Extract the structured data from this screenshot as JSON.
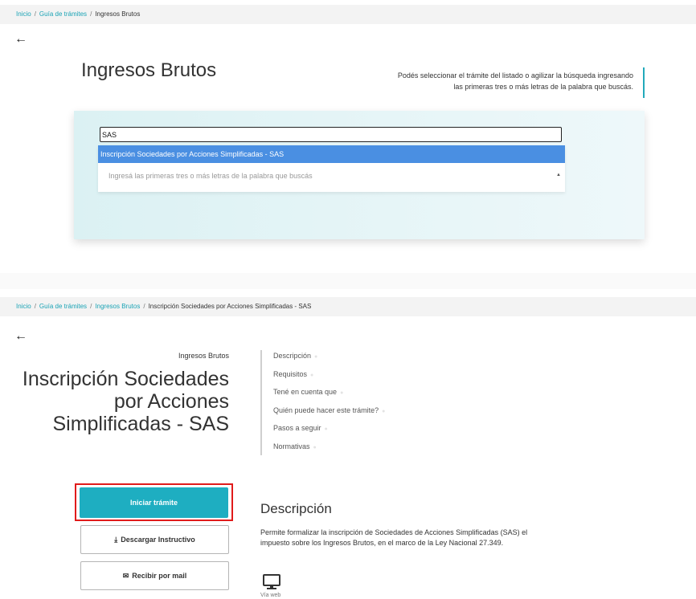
{
  "top": {
    "breadcrumb": {
      "home": "Inicio",
      "guide": "Guía de trámites",
      "current": "Ingresos Brutos",
      "separator": "/"
    },
    "back_icon": "arrow-left-icon",
    "title": "Ingresos Brutos",
    "help_line1": "Podés seleccionar el trámite del listado o agilizar la búsqueda ingresando",
    "help_line2": "las primeras tres o más letras de la palabra que buscás.",
    "search": {
      "value": "SAS",
      "option": "Inscripción Sociedades por Acciones Simplificadas - SAS",
      "placeholder": "Ingresá las primeras tres o más letras de la palabra que buscás"
    }
  },
  "detail": {
    "breadcrumb": {
      "home": "Inicio",
      "guide": "Guía de trámites",
      "category": "Ingresos Brutos",
      "current": "Inscripción Sociedades por Acciones Simplificadas - SAS",
      "separator": "/"
    },
    "back_icon": "arrow-left-icon",
    "category": "Ingresos Brutos",
    "title_line1": "Inscripción Sociedades",
    "title_line2": "por Acciones",
    "title_line3": "Simplificadas - SAS",
    "toc": [
      {
        "label": "Descripción"
      },
      {
        "label": "Requisitos"
      },
      {
        "label": "Tené en cuenta que"
      },
      {
        "label": "Quién puede hacer este trámite?"
      },
      {
        "label": "Pasos a seguir"
      },
      {
        "label": "Normativas"
      }
    ],
    "buttons": {
      "start": "Iniciar trámite",
      "download": "Descargar Instructivo",
      "mail": "Recibir por mail"
    },
    "description": {
      "heading": "Descripción",
      "line1": "Permite formalizar la inscripción de Sociedades de Acciones Simplificadas (SAS) el",
      "line2": "impuesto sobre los Ingresos Brutos, en el marco de la Ley Nacional 27.349."
    },
    "channel": {
      "icon": "monitor-icon",
      "label": "Vía web"
    }
  },
  "colors": {
    "accent": "#1eaec1",
    "link": "#1aa3b5",
    "selected_option": "#4a8fe2",
    "highlight": "#e01b1b"
  }
}
